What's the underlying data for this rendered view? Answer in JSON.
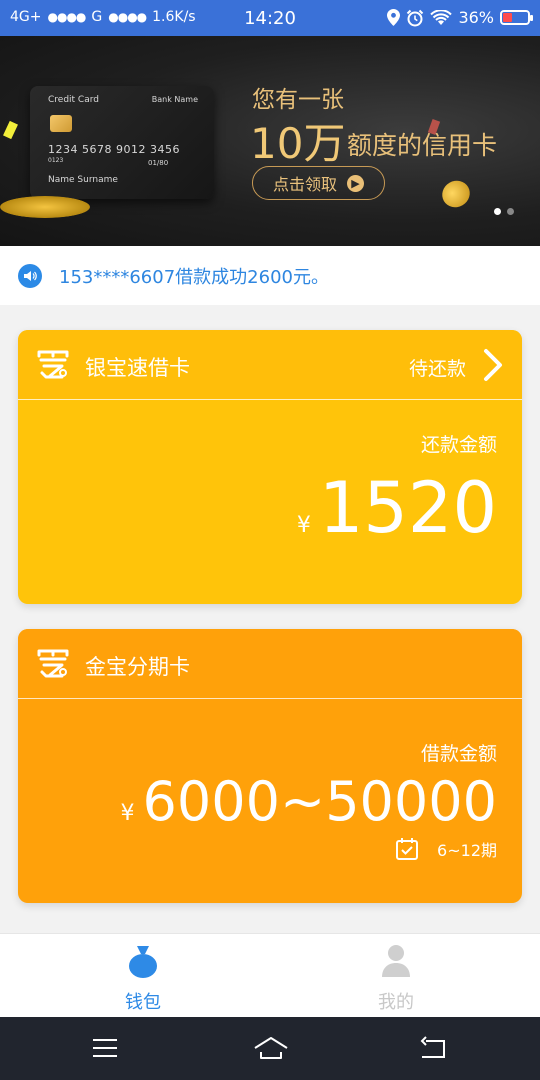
{
  "status_bar": {
    "network1": "4G+",
    "network2": "G",
    "speed": "1.6K/s",
    "time": "14:20",
    "battery": "36%"
  },
  "banner": {
    "card": {
      "label": "Credit Card",
      "bank": "Bank Name",
      "number": "1234  5678  9012  3456",
      "small_num": "0123",
      "expiry": "01/80",
      "holder": "Name Surname"
    },
    "headline1": "您有一张",
    "headline_amount": "10万",
    "headline_rest": "额度的信用卡",
    "button": "点击领取",
    "slides": 2,
    "current_slide": 1
  },
  "notice": {
    "text": "153****6607借款成功2600元。"
  },
  "products": [
    {
      "name": "银宝速借卡",
      "status": "待还款",
      "amount_label": "还款金额",
      "currency": "¥",
      "amount": "1520",
      "color": "#ffc40a"
    },
    {
      "name": "金宝分期卡",
      "amount_label": "借款金额",
      "currency": "¥",
      "amount": "6000~50000",
      "term": "6~12期",
      "color": "#ffa10a"
    }
  ],
  "tabbar": {
    "items": [
      {
        "label": "钱包",
        "icon": "wallet-bag-icon",
        "active": true
      },
      {
        "label": "我的",
        "icon": "person-icon",
        "active": false
      }
    ]
  },
  "navbar": {
    "menu": "menu-icon",
    "home": "home-icon",
    "back": "back-icon"
  },
  "colors": {
    "status_bar": "#3a71d8",
    "accent_blue": "#2e8ae6",
    "gold": "#e8c07a"
  }
}
